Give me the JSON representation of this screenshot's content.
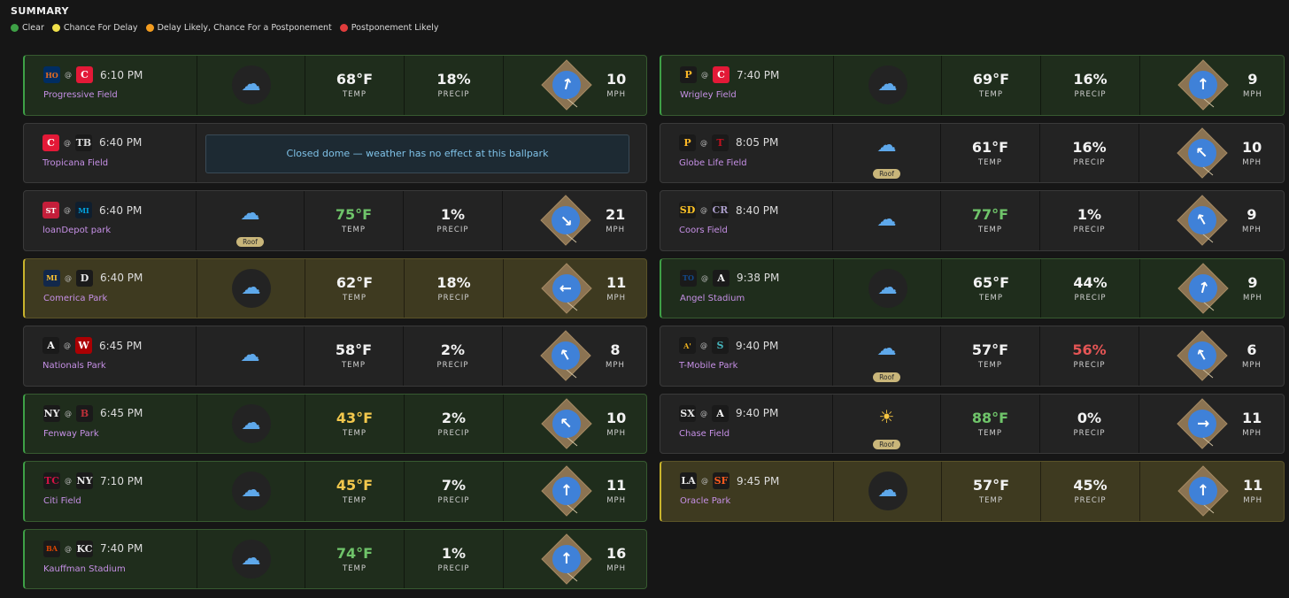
{
  "summary_title": "SUMMARY",
  "legend": [
    {
      "label": "Clear",
      "color": "#3ea046"
    },
    {
      "label": "Chance For Delay",
      "color": "#f0e04a"
    },
    {
      "label": "Delay Likely, Chance For a Postponement",
      "color": "#f39c1f"
    },
    {
      "label": "Postponement Likely",
      "color": "#e03c3c"
    }
  ],
  "games_left": [
    {
      "away": "HOU",
      "home": "C",
      "time": "6:10 PM",
      "park": "Progressive Field",
      "status": "clear",
      "weather": "cloud",
      "roof": false,
      "temp": "68°F",
      "temp_color": "white",
      "precip": "18%",
      "precip_color": "white",
      "wind": "10",
      "wind_dir_deg": 15,
      "labels": {
        "temp": "TEMP",
        "precip": "PRECIP",
        "wind": "MPH"
      }
    },
    {
      "away": "C",
      "home": "TB",
      "time": "6:40 PM",
      "park": "Tropicana Field",
      "status": "dome",
      "dome_text": "Closed dome — weather has no effect at this ballpark"
    },
    {
      "away": "STL",
      "home": "MIA",
      "time": "6:40 PM",
      "park": "loanDepot park",
      "status": "none",
      "weather": "cloud",
      "roof": true,
      "roof_label": "Roof",
      "temp": "75°F",
      "temp_color": "green",
      "precip": "1%",
      "precip_color": "white",
      "wind": "21",
      "wind_dir_deg": 135,
      "labels": {
        "temp": "TEMP",
        "precip": "PRECIP",
        "wind": "MPH"
      }
    },
    {
      "away": "MIL",
      "home": "D",
      "time": "6:40 PM",
      "park": "Comerica Park",
      "status": "delay",
      "weather": "cloud",
      "roof": false,
      "temp": "62°F",
      "temp_color": "white",
      "precip": "18%",
      "precip_color": "white",
      "wind": "11",
      "wind_dir_deg": 270,
      "labels": {
        "temp": "TEMP",
        "precip": "PRECIP",
        "wind": "MPH"
      }
    },
    {
      "away": "A",
      "home": "W",
      "time": "6:45 PM",
      "park": "Nationals Park",
      "status": "none",
      "weather": "cloud",
      "roof": false,
      "temp": "58°F",
      "temp_color": "white",
      "precip": "2%",
      "precip_color": "white",
      "wind": "8",
      "wind_dir_deg": 330,
      "labels": {
        "temp": "TEMP",
        "precip": "PRECIP",
        "wind": "MPH"
      }
    },
    {
      "away": "NY",
      "home": "B",
      "time": "6:45 PM",
      "park": "Fenway Park",
      "status": "clear",
      "weather": "cloud",
      "roof": false,
      "temp": "43°F",
      "temp_color": "yellow",
      "precip": "2%",
      "precip_color": "white",
      "wind": "10",
      "wind_dir_deg": 315,
      "labels": {
        "temp": "TEMP",
        "precip": "PRECIP",
        "wind": "MPH"
      }
    },
    {
      "away": "TC",
      "home": "NY",
      "time": "7:10 PM",
      "park": "Citi Field",
      "status": "clear",
      "weather": "cloud",
      "roof": false,
      "temp": "45°F",
      "temp_color": "yellow",
      "precip": "7%",
      "precip_color": "white",
      "wind": "11",
      "wind_dir_deg": 0,
      "labels": {
        "temp": "TEMP",
        "precip": "PRECIP",
        "wind": "MPH"
      }
    },
    {
      "away": "BAL",
      "home": "KC",
      "time": "7:40 PM",
      "park": "Kauffman Stadium",
      "status": "clear",
      "weather": "cloud",
      "roof": false,
      "temp": "74°F",
      "temp_color": "green",
      "precip": "1%",
      "precip_color": "white",
      "wind": "16",
      "wind_dir_deg": 0,
      "labels": {
        "temp": "TEMP",
        "precip": "PRECIP",
        "wind": "MPH"
      }
    }
  ],
  "games_right": [
    {
      "away": "P",
      "home": "C",
      "time": "7:40 PM",
      "park": "Wrigley Field",
      "status": "clear",
      "weather": "cloud",
      "roof": false,
      "temp": "69°F",
      "temp_color": "white",
      "precip": "16%",
      "precip_color": "white",
      "wind": "9",
      "wind_dir_deg": 0,
      "labels": {
        "temp": "TEMP",
        "precip": "PRECIP",
        "wind": "MPH"
      }
    },
    {
      "away": "P",
      "home": "T",
      "time": "8:05 PM",
      "park": "Globe Life Field",
      "status": "none",
      "weather": "cloud",
      "roof": true,
      "roof_label": "Roof",
      "temp": "61°F",
      "temp_color": "white",
      "precip": "16%",
      "precip_color": "white",
      "wind": "10",
      "wind_dir_deg": 315,
      "labels": {
        "temp": "TEMP",
        "precip": "PRECIP",
        "wind": "MPH"
      }
    },
    {
      "away": "SD",
      "home": "CR",
      "time": "8:40 PM",
      "park": "Coors Field",
      "status": "none",
      "weather": "cloud",
      "roof": false,
      "temp": "77°F",
      "temp_color": "green",
      "precip": "1%",
      "precip_color": "white",
      "wind": "9",
      "wind_dir_deg": 330,
      "labels": {
        "temp": "TEMP",
        "precip": "PRECIP",
        "wind": "MPH"
      }
    },
    {
      "away": "TOR",
      "home": "A",
      "time": "9:38 PM",
      "park": "Angel Stadium",
      "status": "clear",
      "weather": "cloud",
      "roof": false,
      "temp": "65°F",
      "temp_color": "white",
      "precip": "44%",
      "precip_color": "white",
      "wind": "9",
      "wind_dir_deg": 15,
      "labels": {
        "temp": "TEMP",
        "precip": "PRECIP",
        "wind": "MPH"
      }
    },
    {
      "away": "A's",
      "home": "S",
      "time": "9:40 PM",
      "park": "T-Mobile Park",
      "status": "none",
      "weather": "cloud",
      "roof": true,
      "roof_label": "Roof",
      "temp": "57°F",
      "temp_color": "white",
      "precip": "56%",
      "precip_color": "red",
      "wind": "6",
      "wind_dir_deg": 330,
      "labels": {
        "temp": "TEMP",
        "precip": "PRECIP",
        "wind": "MPH"
      }
    },
    {
      "away": "SX",
      "home": "A",
      "time": "9:40 PM",
      "park": "Chase Field",
      "status": "none",
      "weather": "sun",
      "roof": true,
      "roof_label": "Roof",
      "temp": "88°F",
      "temp_color": "green",
      "precip": "0%",
      "precip_color": "white",
      "wind": "11",
      "wind_dir_deg": 90,
      "labels": {
        "temp": "TEMP",
        "precip": "PRECIP",
        "wind": "MPH"
      }
    },
    {
      "away": "LA",
      "home": "SF",
      "time": "9:45 PM",
      "park": "Oracle Park",
      "status": "delay",
      "weather": "cloud-rain",
      "roof": false,
      "temp": "57°F",
      "temp_color": "white",
      "precip": "45%",
      "precip_color": "white",
      "wind": "11",
      "wind_dir_deg": 0,
      "labels": {
        "temp": "TEMP",
        "precip": "PRECIP",
        "wind": "MPH"
      }
    }
  ],
  "team_colors": {
    "HOU": [
      "#002d62",
      "#eb6e1f"
    ],
    "C": [
      "#e31937",
      "#ffffff"
    ],
    "TB": [
      "#1a1a1a",
      "#d8d8d8"
    ],
    "STL": [
      "#c41e3a",
      "#ffffff"
    ],
    "MIA": [
      "#0f1e2e",
      "#00a3e0"
    ],
    "MIL": [
      "#12284b",
      "#ffc52f"
    ],
    "D": [
      "#1a1a1a",
      "#e8e8e8"
    ],
    "A": [
      "#1a1a1a",
      "#ffffff"
    ],
    "W": [
      "#ab0003",
      "#ffffff"
    ],
    "NY": [
      "#1a1a1a",
      "#e8e8e8"
    ],
    "B": [
      "#1a1a1a",
      "#bd3039"
    ],
    "TC": [
      "#1a1a1a",
      "#d31145"
    ],
    "BAL": [
      "#1a1a1a",
      "#df4601"
    ],
    "KC": [
      "#1a1a1a",
      "#e8e8e8"
    ],
    "P": [
      "#1a1a1a",
      "#fdb827"
    ],
    "T": [
      "#1a1a1a",
      "#c0111f"
    ],
    "SD": [
      "#1a1a1a",
      "#ffc425"
    ],
    "CR": [
      "#1a1a1a",
      "#a89bc7"
    ],
    "TOR": [
      "#1a1a1a",
      "#134a8e"
    ],
    "A's": [
      "#1a1a1a",
      "#efb21e"
    ],
    "S": [
      "#1a1a1a",
      "#46b6bd"
    ],
    "SX": [
      "#1a1a1a",
      "#e8e8e8"
    ],
    "LA": [
      "#1a1a1a",
      "#e8e8e8"
    ],
    "SF": [
      "#1a1a1a",
      "#fd5a1e"
    ]
  }
}
